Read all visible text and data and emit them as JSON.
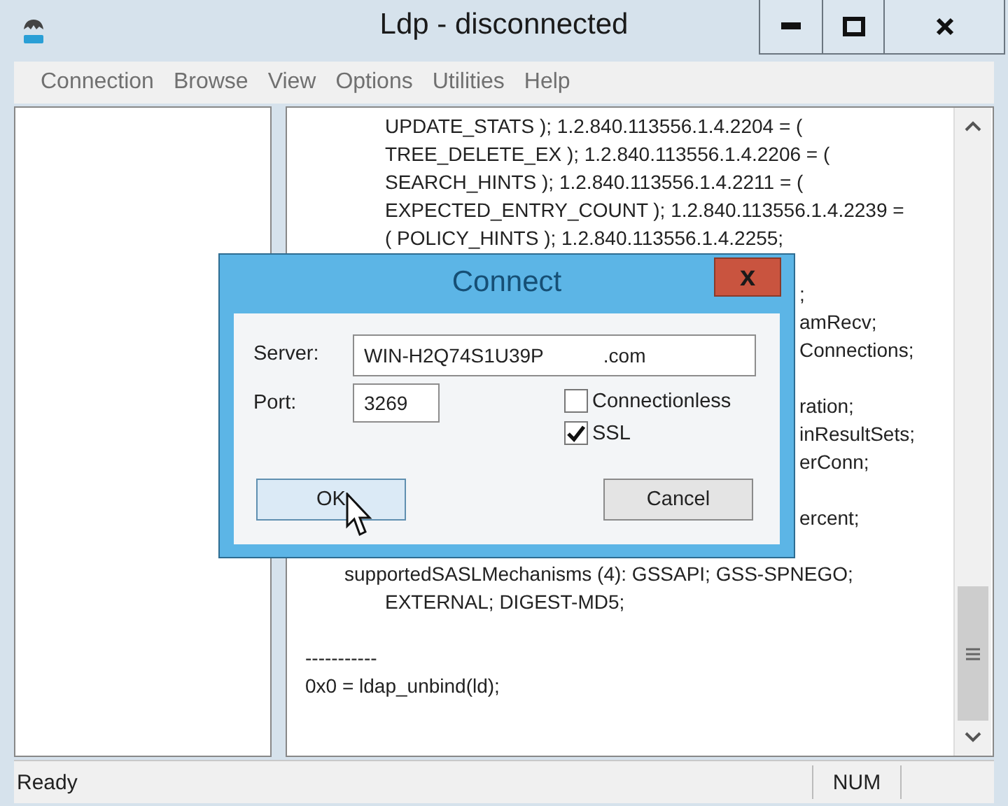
{
  "window": {
    "title": "Ldp - disconnected"
  },
  "menu": [
    {
      "label": "Connection"
    },
    {
      "label": "Browse"
    },
    {
      "label": "View"
    },
    {
      "label": "Options"
    },
    {
      "label": "Utilities"
    },
    {
      "label": "Help"
    }
  ],
  "output": [
    {
      "kind": "wrapped",
      "text": "UPDATE_STATS ); 1.2.840.113556.1.4.2204 = ("
    },
    {
      "kind": "wrapped",
      "text": "TREE_DELETE_EX ); 1.2.840.113556.1.4.2206 = ("
    },
    {
      "kind": "wrapped",
      "text": "SEARCH_HINTS ); 1.2.840.113556.1.4.2211 = ("
    },
    {
      "kind": "wrapped",
      "text": "EXPECTED_ENTRY_COUNT ); 1.2.840.113556.1.4.2239 ="
    },
    {
      "kind": "wrapped",
      "text": "( POLICY_HINTS ); 1.2.840.113556.1.4.2255;"
    },
    {
      "kind": "hidden"
    },
    {
      "kind": "fragment",
      "text": ";"
    },
    {
      "kind": "fragment",
      "text": "amRecv;"
    },
    {
      "kind": "fragment",
      "text": "Connections;"
    },
    {
      "kind": "hidden"
    },
    {
      "kind": "fragment",
      "text": "ration;"
    },
    {
      "kind": "fragment",
      "text": "inResultSets;"
    },
    {
      "kind": "fragment",
      "text": "erConn;"
    },
    {
      "kind": "hidden"
    },
    {
      "kind": "fragment",
      "text": "ercent;"
    },
    {
      "kind": "hidden"
    },
    {
      "kind": "attribute",
      "text": "supportedSASLMechanisms (4): GSSAPI; GSS-SPNEGO;"
    },
    {
      "kind": "wrapped",
      "text": "EXTERNAL; DIGEST-MD5;"
    },
    {
      "kind": "hidden"
    },
    {
      "kind": "plain",
      "text": "-----------"
    },
    {
      "kind": "plain",
      "text": "0x0 = ldap_unbind(ld);"
    }
  ],
  "dialog": {
    "title": "Connect",
    "close": "x",
    "server_label": "Server:",
    "server_value": "WIN-H2Q74S1U39P           .com",
    "port_label": "Port:",
    "port_value": "3269",
    "options": [
      {
        "label": "Connectionless",
        "checked": false
      },
      {
        "label": "SSL",
        "checked": true
      }
    ],
    "buttons": [
      {
        "label": "OK",
        "hovered": true
      },
      {
        "label": "Cancel",
        "hovered": false
      }
    ]
  },
  "status_bar": {
    "text": "Ready",
    "num": "NUM"
  }
}
